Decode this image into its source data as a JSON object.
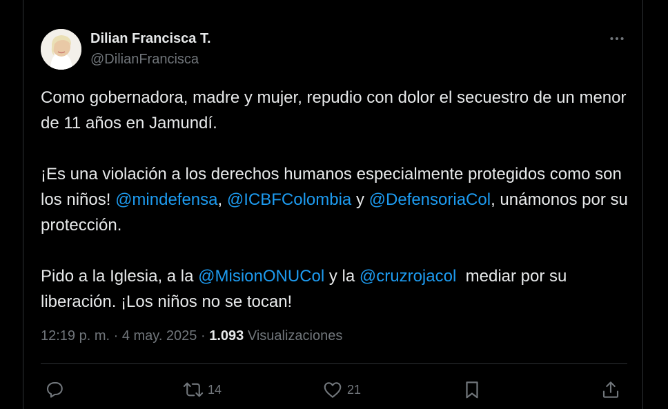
{
  "author": {
    "name": "Dilian Francisca T.",
    "handle": "@DilianFrancisca"
  },
  "tweet": {
    "line1": "Como gobernadora, madre y mujer, repudio con dolor el secuestro de un menor de 11 años en Jamundí.",
    "p2_text1": "¡Es una violación a los derechos humanos especialmente protegidos como son los niños! ",
    "p2_mention1": "@mindefensa",
    "p2_text2": ", ",
    "p2_mention2": "@ICBFColombia",
    "p2_text3": " y ",
    "p2_mention3": "@DefensoriaCol",
    "p2_text4": ", unámonos por su protección.",
    "p3_text1": "Pido a la Iglesia, a la ",
    "p3_mention1": "@MisionONUCol",
    "p3_text2": " y la ",
    "p3_mention2": "@cruzrojacol",
    "p3_text3": "  mediar por su liberación. ¡Los niños no se tocan!"
  },
  "meta": {
    "time": "12:19 p. m.",
    "sep1": " · ",
    "date": "4 may. 2025",
    "sep2": " · ",
    "views_count": "1.093",
    "views_label": " Visualizaciones"
  },
  "actions": {
    "retweets": "14",
    "likes": "21"
  },
  "icons": {
    "more": "more-horizontal-icon",
    "reply": "reply-icon",
    "retweet": "retweet-icon",
    "like": "heart-icon",
    "bookmark": "bookmark-icon",
    "share": "share-icon"
  },
  "colors": {
    "background": "#000000",
    "text": "#e7e9ea",
    "secondary": "#71767b",
    "link": "#1d9bf0",
    "border": "#2f3336"
  }
}
